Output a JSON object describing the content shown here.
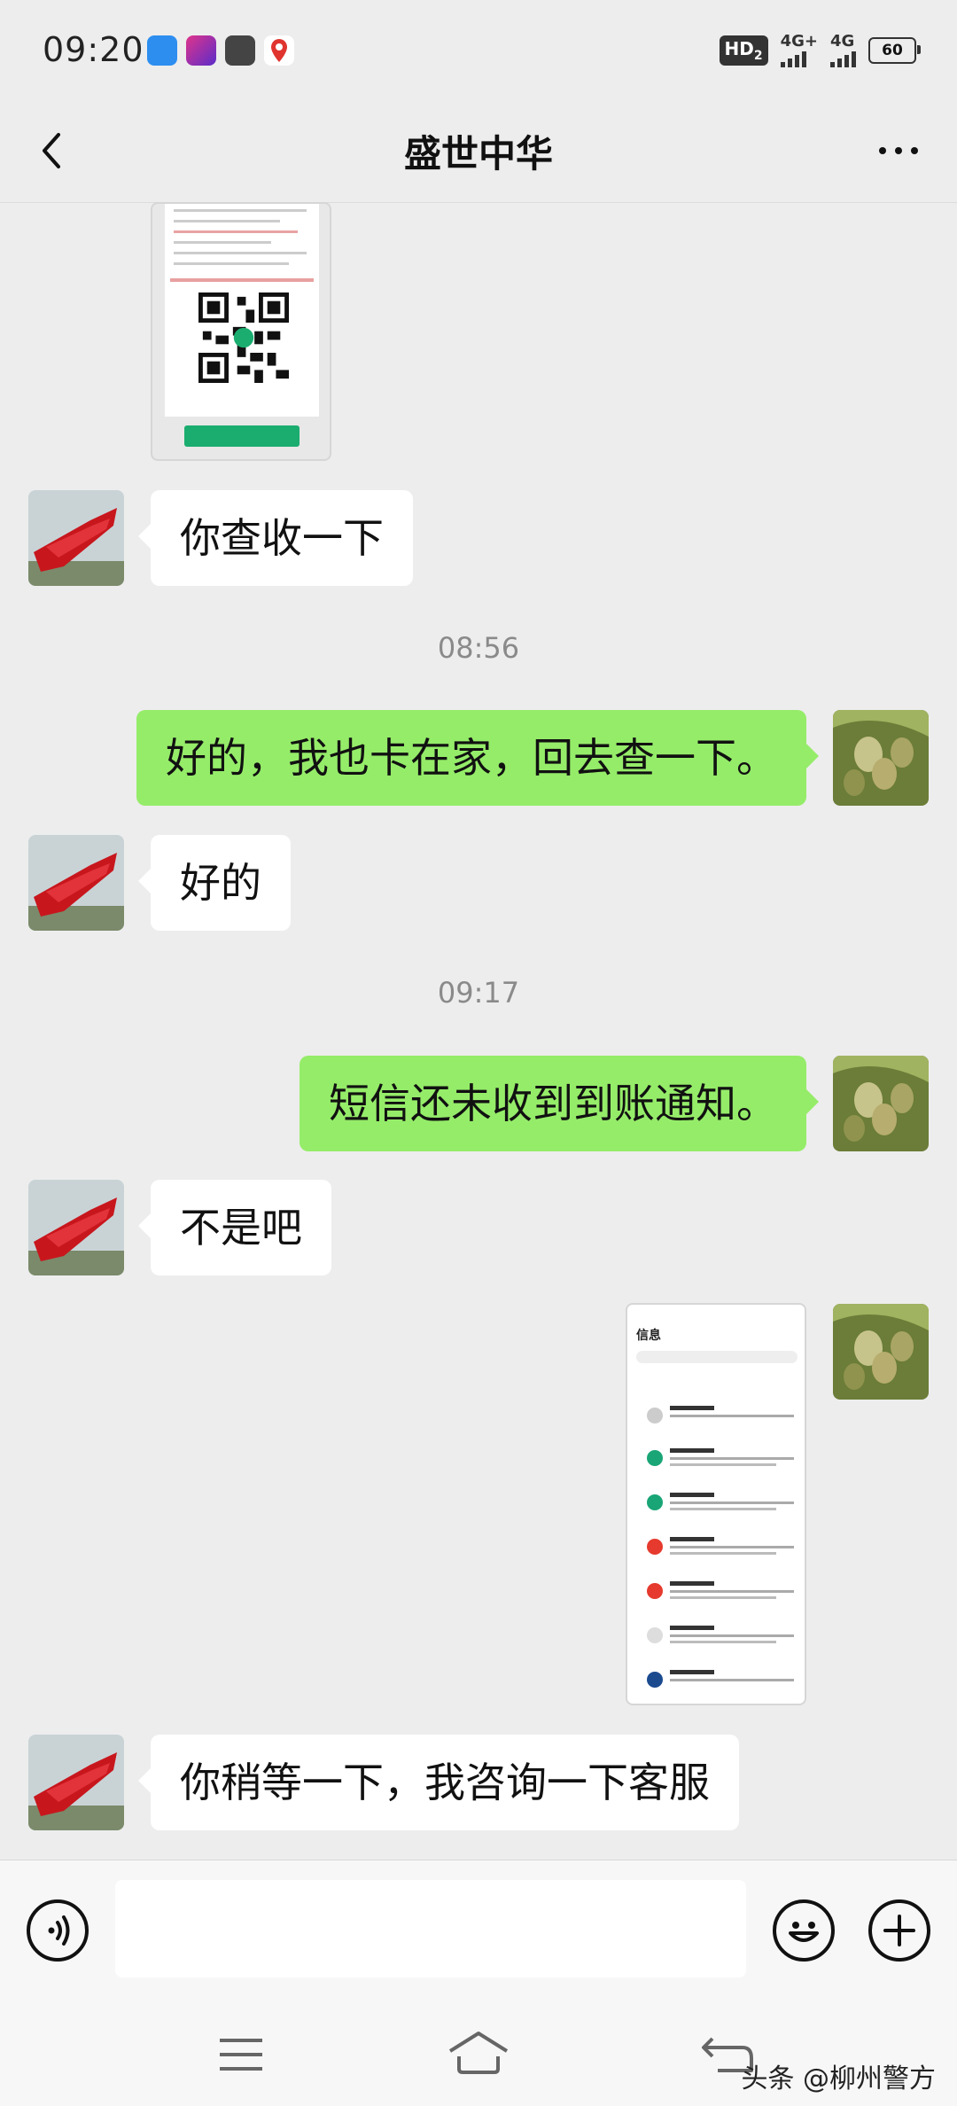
{
  "status_bar": {
    "time": "09:20",
    "hd_label": "HD",
    "hd_sub": "2",
    "sim1_network": "4G+",
    "sim2_network": "4G",
    "battery": "60"
  },
  "header": {
    "title": "盛世中华",
    "back_icon": "chevron-left-icon",
    "more_icon": "more-dots-icon"
  },
  "messages": {
    "m1": "你查收一下",
    "t1": "08:56",
    "m2": "好的，我也卡在家，回去查一下。",
    "m3": "好的",
    "t2": "09:17",
    "m4": "短信还未收到到账通知。",
    "m5": "不是吧",
    "m6": "你稍等一下，我咨询一下客服"
  },
  "sms_screenshot": {
    "title": "信息"
  },
  "input_bar": {
    "voice_icon": "voice-icon",
    "emoji_icon": "emoji-icon",
    "plus_icon": "plus-icon",
    "value": ""
  },
  "watermark": "头条 @柳州警方",
  "colors": {
    "background": "#ededed",
    "outgoing_bubble": "#95ec69",
    "incoming_bubble": "#ffffff"
  }
}
